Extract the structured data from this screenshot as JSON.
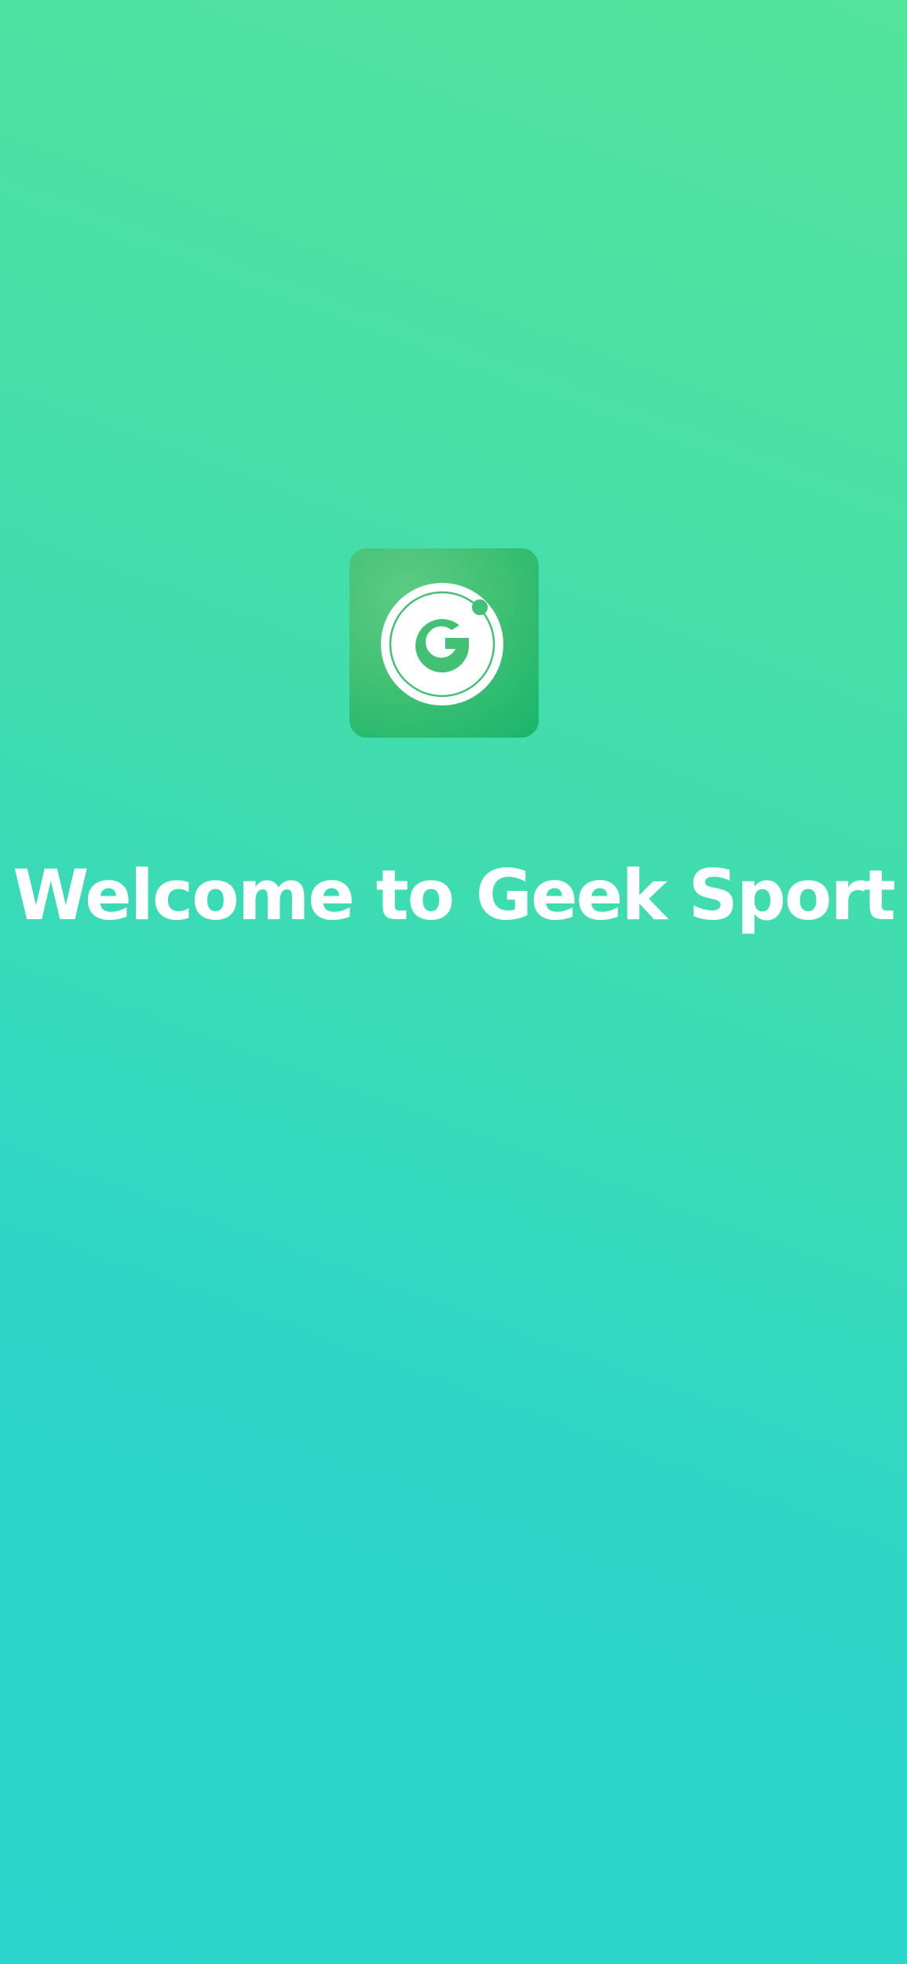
{
  "splash": {
    "welcome_text": "Welcome to Geek Sport",
    "logo_icon": "geek-sport-g-logo",
    "colors": {
      "background_top": "#54e49b",
      "background_bottom": "#2bd5cb",
      "logo_tile": "#42c175",
      "logo_mark": "#ffffff",
      "title_text": "#ffffff"
    }
  }
}
